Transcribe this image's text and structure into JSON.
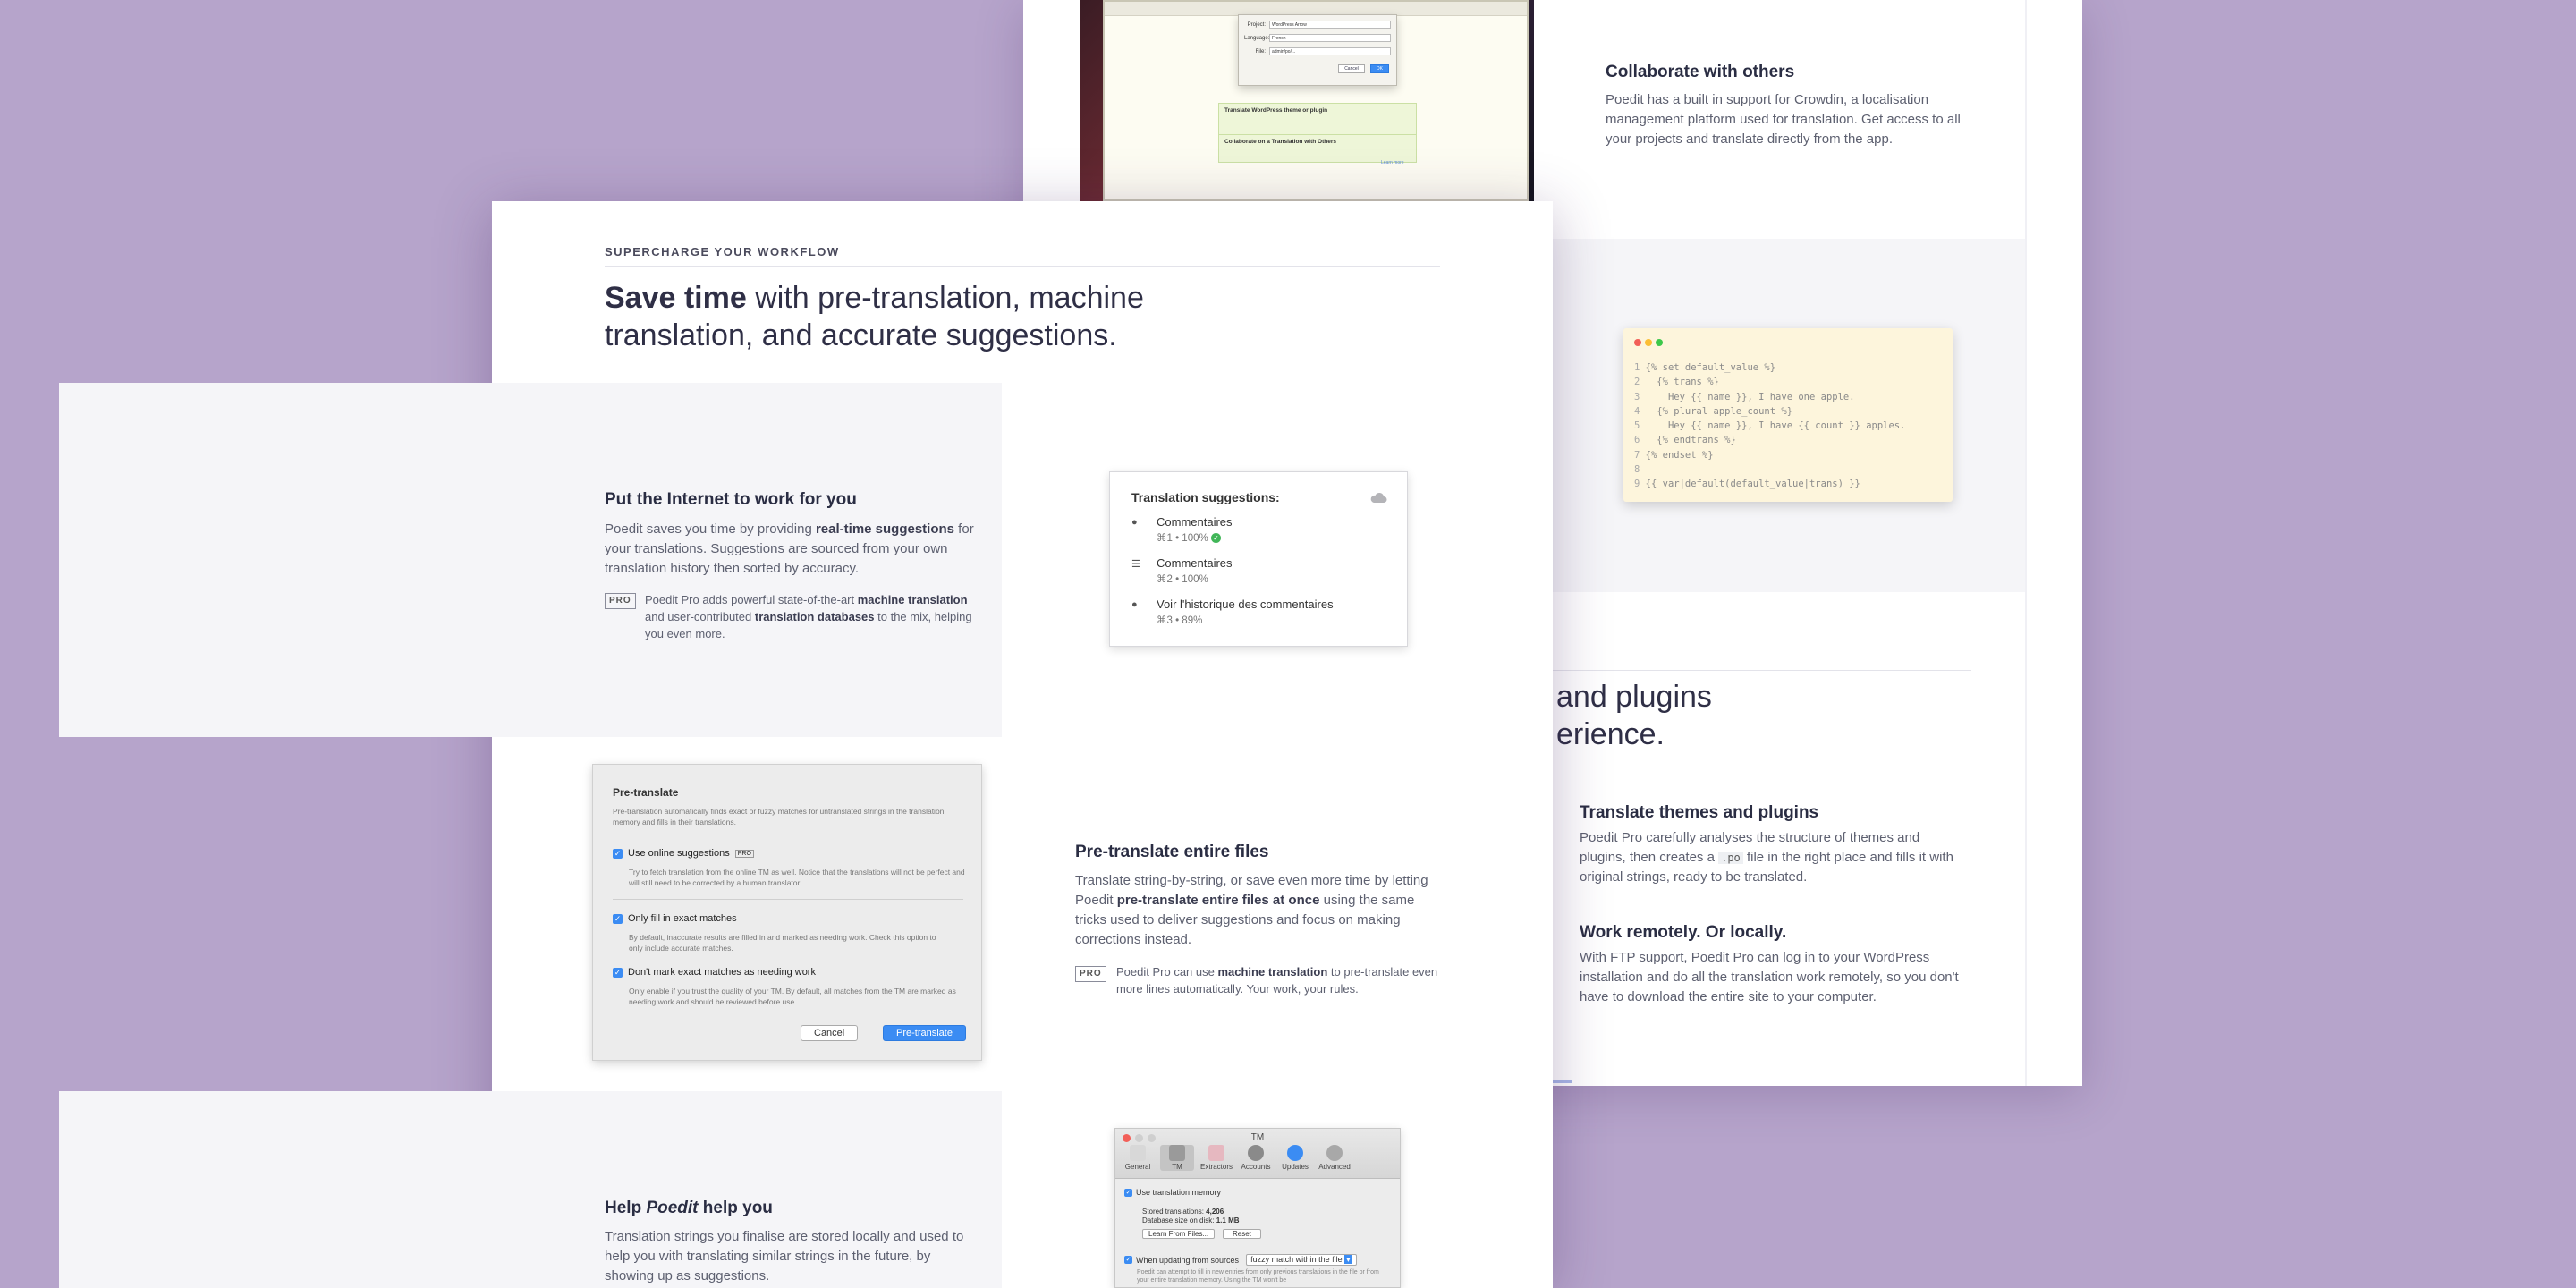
{
  "back": {
    "collab_title": "Collaborate with others",
    "collab_text": "Poedit has a built in support for Crowdin, a localisation management platform used for translation. Get access to all your projects and translate directly from the app.",
    "dialog": {
      "project_label": "Project:",
      "project_value": "WordPress Arrow",
      "language_label": "Language:",
      "language_value": "French",
      "file_label": "File:",
      "file_value": "admin/po/...",
      "cancel": "Cancel",
      "ok": "OK"
    },
    "wp_item_title": "Translate WordPress theme or plugin",
    "collab_item_title": "Collaborate on a Translation with Others",
    "more_link": "Learn more",
    "code_lines": [
      "{% set default_value %}",
      "  {% trans %}",
      "    Hey {{ name }}, I have one apple.",
      "  {% plural apple_count %}",
      "    Hey {{ name }}, I have {{ count }} apples.",
      "  {% endtrans %}",
      "{% endset %}",
      "",
      "{{ var|default(default_value|trans) }}"
    ],
    "heading_line1": " and plugins",
    "heading_line2": "erience.",
    "themes_title": "Translate themes and plugins",
    "themes_text_a": "Poedit Pro carefully analyses the structure of themes and plugins, then creates a",
    "themes_code": ".po",
    "themes_text_b": "file in the right place and fills it with original strings, ready to be translated.",
    "remote_title": "Work remotely. Or locally.",
    "remote_text": "With FTP support, Poedit Pro can log in to your WordPress installation and do all the translation work remotely, so you don't have to download the entire site to your computer."
  },
  "front": {
    "eyebrow": "SUPERCHARGE YOUR WORKFLOW",
    "hero_bold": "Save time",
    "hero_rest1": " with pre-translation, machine",
    "hero_rest2": "translation, and accurate suggestions.",
    "internet": {
      "title": "Put the Internet to work for you",
      "p_a": "Poedit saves you time by providing ",
      "p_b": "real-time suggestions",
      "p_c": " for your translations. Suggestions are sourced from your own translation history then sorted by accuracy.",
      "pro": "PRO",
      "pro_a": "Poedit Pro adds powerful state-of-the-art ",
      "pro_b": "machine translation",
      "pro_c": " and user-contributed ",
      "pro_d": "translation databases",
      "pro_e": " to the mix, helping you even more."
    },
    "suggestions": {
      "title": "Translation suggestions:",
      "items": [
        {
          "text": "Commentaires",
          "meta": "⌘1 • 100%"
        },
        {
          "text": "Commentaires",
          "meta": "⌘2 • 100%"
        },
        {
          "text": "Voir l'historique des commentaires",
          "meta": "⌘3 • 89%"
        }
      ]
    },
    "pretranslate_dialog": {
      "title": "Pre-translate",
      "desc": "Pre-translation automatically finds exact or fuzzy matches for untranslated strings in the translation memory and fills in their translations.",
      "opt1": "Use online suggestions",
      "opt1_badge": "PRO",
      "opt1_desc": "Try to fetch translation from the online TM as well. Notice that the translations will not be perfect and will still need to be corrected by a human translator.",
      "opt2": "Only fill in exact matches",
      "opt2_desc": "By default, inaccurate results are filled in and marked as needing work. Check this option to only include accurate matches.",
      "opt3": "Don't mark exact matches as needing work",
      "opt3_desc": "Only enable if you trust the quality of your TM. By default, all matches from the TM are marked as needing work and should be reviewed before use.",
      "cancel": "Cancel",
      "ok": "Pre-translate"
    },
    "pretranslate": {
      "title": "Pre-translate entire files",
      "p_a": "Translate string-by-string, or save even more time by letting Poedit ",
      "p_b": "pre-translate entire files at once",
      "p_c": " using the same tricks used to deliver suggestions and focus on making corrections instead.",
      "pro": "PRO",
      "pro_a": "Poedit Pro can use ",
      "pro_b": "machine translation",
      "pro_c": " to pre-translate even more lines automatically. Your work, your rules."
    },
    "help": {
      "title_a": "Help ",
      "title_b": "Poedit",
      "title_c": " help you",
      "text": "Translation strings you finalise are stored locally and used to help you with translating similar strings in the future, by showing up as suggestions."
    },
    "tm_window": {
      "title": "TM",
      "tabs": [
        "General",
        "TM",
        "Extractors",
        "Accounts",
        "Updates",
        "Advanced"
      ],
      "use_tm": "Use translation memory",
      "stored_label": "Stored translations:",
      "stored_value": "4,206",
      "db_label": "Database size on disk:",
      "db_value": "1.1 MB",
      "learn_btn": "Learn From Files...",
      "reset_btn": "Reset",
      "when_updating": "When updating from sources",
      "select_value": "fuzzy match within the file",
      "fine_print": "Poedit can attempt to fill in new entries from only previous translations in the file or from your entire translation memory. Using the TM won't be"
    }
  }
}
